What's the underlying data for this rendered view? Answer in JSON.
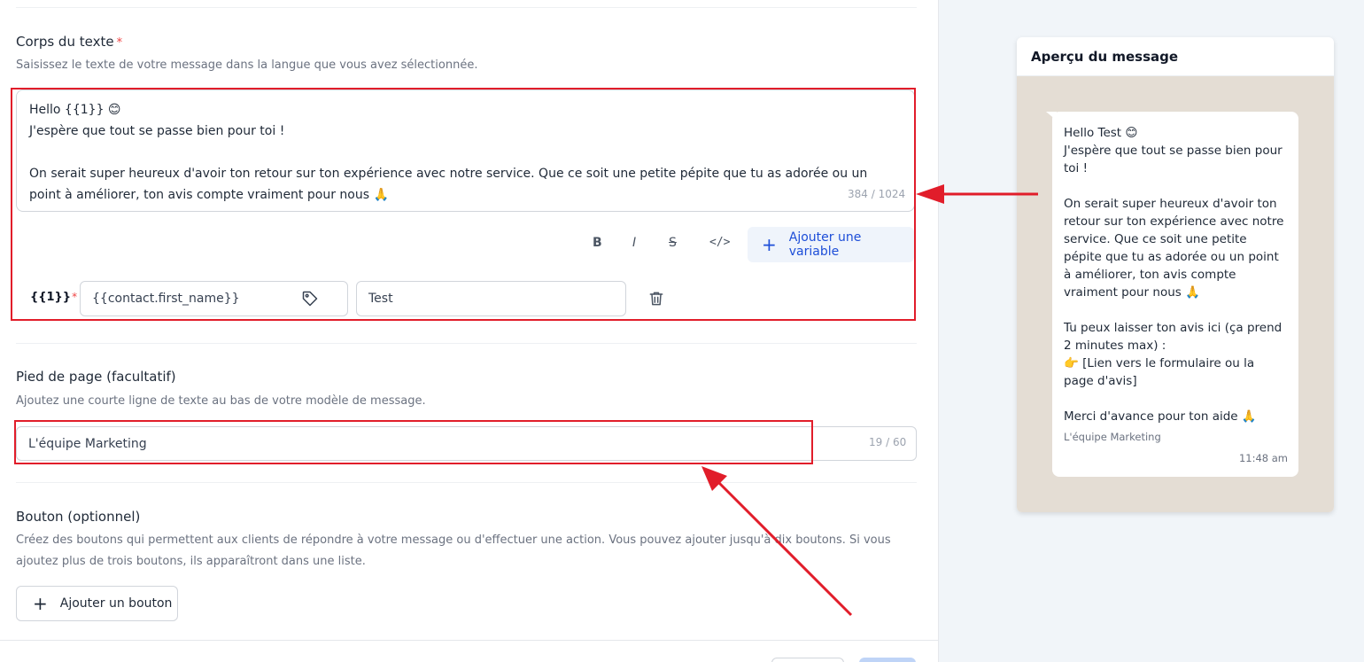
{
  "body_section": {
    "title": "Corps du texte",
    "required_mark": "*",
    "description": "Saisissez le texte de votre message dans la langue que vous avez sélectionnée.",
    "text_line1": "Hello {{1}} 😊",
    "text_line2": "J'espère que tout se passe bien pour toi !",
    "text_line3": "On serait super heureux d'avoir ton retour sur ton expérience avec notre service. Que ce soit une petite pépite que tu as adorée ou un",
    "text_line4": "point à améliorer, ton avis compte vraiment pour nous 🙏",
    "counter": "384 / 1024",
    "format_bold": "B",
    "format_italic": "I",
    "format_strike": "S",
    "format_code": "</>",
    "add_variable_label": "Ajouter une variable",
    "variable": {
      "label": "{{1}}",
      "required_mark": "*",
      "field_value": "{{contact.first_name}}",
      "sample_value": "Test"
    }
  },
  "footer_section": {
    "title": "Pied de page (facultatif)",
    "description": "Ajoutez une courte ligne de texte au bas de votre modèle de message.",
    "value": "L'équipe Marketing",
    "counter": "19 / 60"
  },
  "buttons_section": {
    "title": "Bouton (optionnel)",
    "description_line1": "Créez des boutons qui permettent aux clients de répondre à votre message ou d'effectuer une action. Vous pouvez ajouter jusqu'à dix boutons. Si vous",
    "description_line2": "ajoutez plus de trois boutons, ils apparaîtront dans une liste.",
    "add_button_label": "Ajouter un bouton"
  },
  "preview": {
    "title": "Aperçu du message",
    "message": "Hello  Test 😊\nJ'espère que tout se passe bien pour toi !\n\nOn serait super heureux d'avoir ton retour sur ton expérience avec notre service. Que ce soit une petite pépite que tu as adorée ou un point à améliorer, ton avis compte vraiment pour nous 🙏\n\nTu peux laisser ton avis ici (ça prend 2 minutes max) :\n👉 [Lien vers le formulaire ou la page d'avis]\n\nMerci d'avance pour ton aide 🙏",
    "footer": "L'équipe Marketing",
    "time": "11:48 am"
  },
  "colors": {
    "accent": "#1d4ed8",
    "annotation_red": "#e11d2a",
    "preview_background": "#e4ddd4"
  }
}
